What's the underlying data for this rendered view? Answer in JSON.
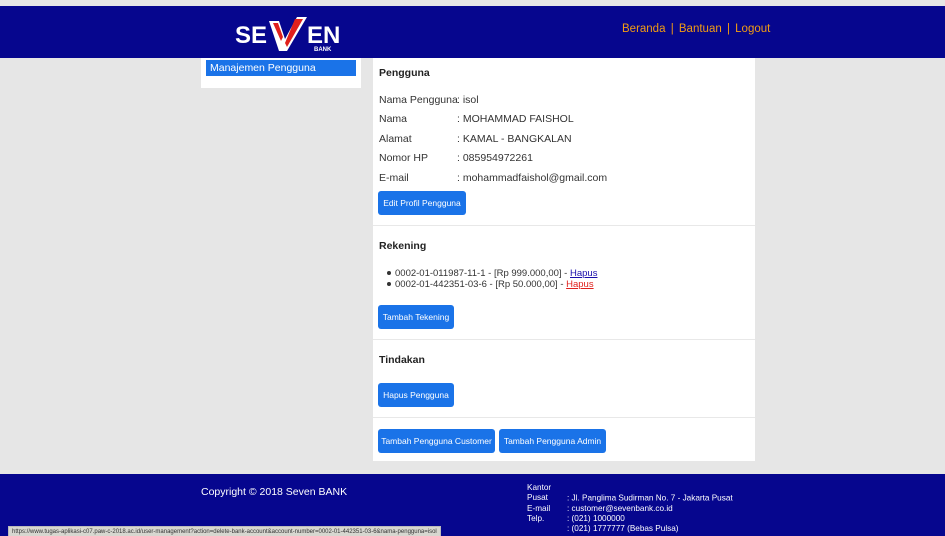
{
  "brand": {
    "logo_text_left": "SE",
    "logo_text_right": "EN",
    "logo_sub": "BANK"
  },
  "nav": {
    "home": "Beranda",
    "help": "Bantuan",
    "logout": "Logout",
    "sep": "|"
  },
  "sidebar": {
    "active_item": "Manajemen Pengguna"
  },
  "user": {
    "section_title": "Pengguna",
    "fields": [
      {
        "label": "Nama Pengguna",
        "value": ": isol"
      },
      {
        "label": "Nama",
        "value": ": MOHAMMAD FAISHOL"
      },
      {
        "label": "Alamat",
        "value": ": KAMAL - BANGKALAN"
      },
      {
        "label": "Nomor HP",
        "value": ": 085954972261"
      },
      {
        "label": "E-mail",
        "value": ": mohammadfaishol@gmail.com"
      }
    ],
    "edit_button": "Edit Profil Pengguna"
  },
  "accounts": {
    "section_title": "Rekening",
    "items": [
      {
        "text": "0002-01-011987-11-1 - [Rp 999.000,00] - ",
        "link": "Hapus"
      },
      {
        "text": "0002-01-442351-03-6 - [Rp 50.000,00] - ",
        "link": "Hapus"
      }
    ],
    "add_button": "Tambah Tekening"
  },
  "actions": {
    "section_title": "Tindakan",
    "delete_button": "Hapus Pengguna",
    "add_customer_button": "Tambah Pengguna Customer",
    "add_admin_button": "Tambah Pengguna Admin"
  },
  "footer": {
    "copyright": "Copyright © 2018 Seven BANK",
    "contact": [
      {
        "key": "Kantor Pusat",
        "value": ": Jl. Panglima Sudirman No. 7 - Jakarta Pusat"
      },
      {
        "key": "E-mail",
        "value": ": customer@sevenbank.co.id"
      },
      {
        "key": "Telp.",
        "value": ": (021) 1000000"
      },
      {
        "key": "",
        "value": ": (021) 1777777 (Bebas Pulsa)"
      }
    ]
  },
  "status_url": "https://www.tugas-aplikasi-c07.paw-c-2018.ac.id/user-management?action=delete-bank-account&account-number=0002-01-442351-03-6&nama-pengguna=isol",
  "colors": {
    "header_bg": "#06068e",
    "accent": "#1a73e8",
    "nav_link": "#f39c12",
    "danger_link": "#e0201c"
  }
}
